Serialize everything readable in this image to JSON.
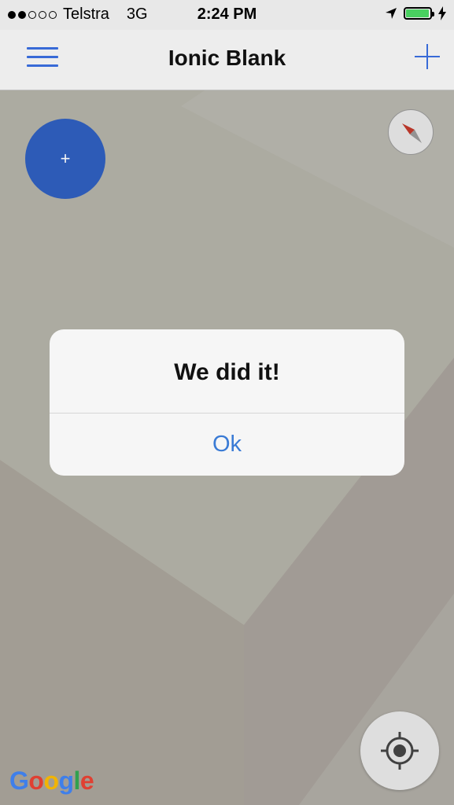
{
  "status_bar": {
    "carrier": "Telstra",
    "network": "3G",
    "time": "2:24 PM",
    "signal_dots_filled": 2,
    "signal_dots_total": 5,
    "battery_level": 0.95,
    "battery_color": "#4cd964",
    "icons": [
      "location-arrow-icon",
      "battery-icon",
      "charging-bolt-icon"
    ]
  },
  "header": {
    "title": "Ionic Blank",
    "menu_icon": "hamburger-icon",
    "add_icon": "plus-icon",
    "accent_color": "#3b6fe0"
  },
  "map": {
    "fab_label": "+",
    "fab_color": "#2f5fbf",
    "compass_icon": "compass-icon",
    "locate_icon": "crosshair-icon",
    "attribution_letters": [
      "G",
      "o",
      "o",
      "g",
      "l",
      "e"
    ],
    "attribution_colors": [
      "#4285f4",
      "#ea4335",
      "#fbbc05",
      "#4285f4",
      "#34a853",
      "#ea4335"
    ]
  },
  "dialog": {
    "message": "We did it!",
    "ok_label": "Ok",
    "ok_color": "#3a7bd5"
  }
}
